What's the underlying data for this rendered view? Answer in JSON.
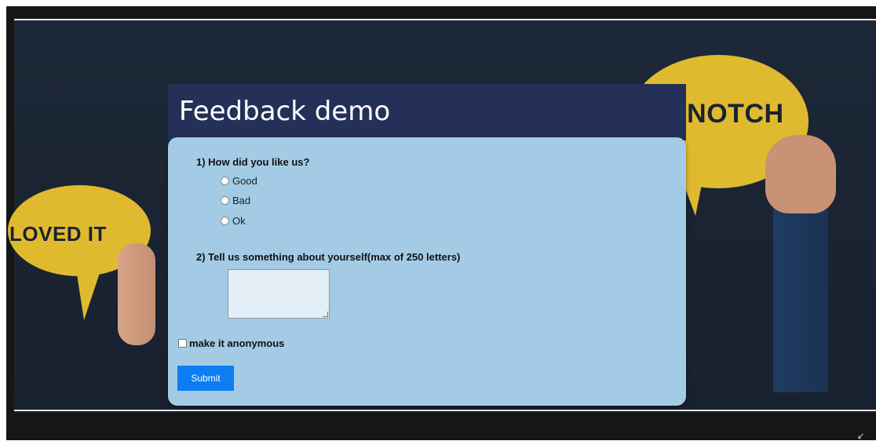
{
  "form": {
    "title": "Feedback demo",
    "question1": "1) How did you like us?",
    "options": [
      "Good",
      "Bad",
      "Ok"
    ],
    "question2": "2) Tell us something about yourself(max of 250 letters)",
    "textarea_value": "",
    "anonymous_label": "make it anonymous",
    "submit_label": "Submit"
  },
  "background": {
    "left_bubble_text": "LOVED IT",
    "right_bubble_text": "PNOTCH"
  },
  "colors": {
    "card": "#a3cbe5",
    "title_band": "#253058",
    "submit": "#0d7df4",
    "bubble": "#e0ba2e"
  }
}
